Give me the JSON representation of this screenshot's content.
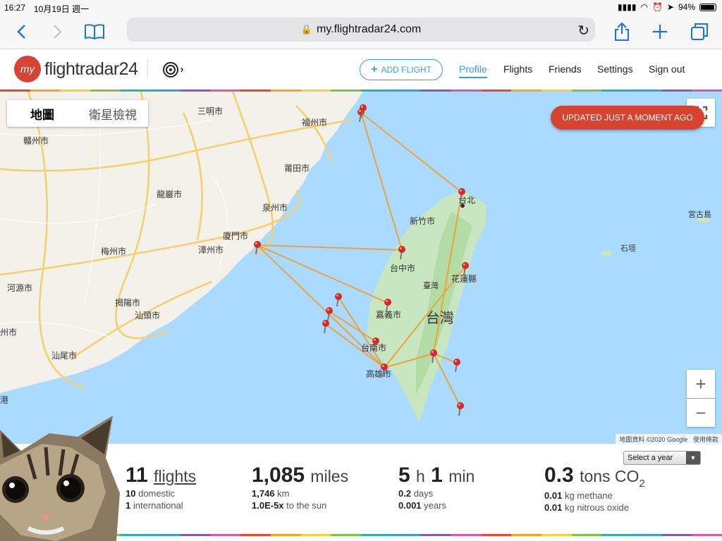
{
  "status_bar": {
    "time": "16:27",
    "date": "10月19日 週一",
    "battery": "94%",
    "battery_level": 0.94
  },
  "browser": {
    "url": "my.flightradar24.com",
    "icons": [
      "back-icon",
      "forward-icon",
      "bookmarks-icon",
      "lock-icon",
      "reload-icon",
      "share-icon",
      "new-tab-icon",
      "tabs-icon"
    ]
  },
  "header": {
    "logo_my": "my",
    "logo_text": "flightradar24",
    "add_flight": "ADD FLIGHT",
    "nav": [
      "Profile",
      "Flights",
      "Friends",
      "Settings",
      "Sign out"
    ],
    "active_nav": "Profile",
    "strip_colors": [
      "#e8482f",
      "#f6a623",
      "#f3d23b",
      "#7dc243",
      "#2ab3a6",
      "#3a9fd8",
      "#8a58b6",
      "#e05aa0"
    ]
  },
  "map": {
    "type_tabs": [
      "地圖",
      "衛星檢視"
    ],
    "selected_type": "地圖",
    "updated_badge": "UPDATED JUST A MOMENT AGO",
    "zoom_in": "+",
    "zoom_out": "−",
    "attribution": "地圖資料 ©2020 Google",
    "terms": "使用條款",
    "labels": {
      "sanming": "三明市",
      "fuzhou": "福州市",
      "ganzhou": "贛州市",
      "putian": "莆田市",
      "longyan": "龍巖市",
      "quanzhou": "泉州市",
      "xiamen": "廈門市",
      "zhangzhou": "漳州市",
      "meizhou": "梅州市",
      "heyuan": "河源市",
      "jieyang": "揭陽市",
      "shantou": "汕頭市",
      "zhou": "州市",
      "shanwei": "汕尾市",
      "gang": "港",
      "taipei": "台北",
      "hsinchu": "新竹市",
      "taichung": "台中市",
      "taiwan_small": "臺灣",
      "hualien": "花蓮縣",
      "chiayi": "嘉義市",
      "taiwan": "台灣",
      "tainan": "台南市",
      "kaohsiung": "高雄市",
      "miyako": "宮古島",
      "ishigaki": "石垣"
    },
    "colors": {
      "land": "#f3f1ea",
      "sea": "#aadaff",
      "taiwan": "#c8e6c0",
      "route": "#eba33a",
      "pin": "#d62a2a",
      "road": "#f5cf6a"
    }
  },
  "stats": {
    "year_select": "Select a year",
    "flights": {
      "value": "11",
      "unit": "flights",
      "sub1_val": "10",
      "sub1": "domestic",
      "sub2_val": "1",
      "sub2": "international"
    },
    "distance": {
      "value": "1,085",
      "unit": "miles",
      "sub1_val": "1,746",
      "sub1": "km",
      "sub2_val": "1.0E-5x",
      "sub2": "to the sun"
    },
    "time": {
      "hours": "5",
      "h_unit": "h",
      "minutes": "1",
      "m_unit": "min",
      "sub1_val": "0.2",
      "sub1": "days",
      "sub2_val": "0.001",
      "sub2": "years"
    },
    "co2": {
      "value": "0.3",
      "unit": "tons CO",
      "unit_sub": "2",
      "sub1_val": "0.01",
      "sub1": "kg methane",
      "sub2_val": "0.01",
      "sub2": "kg nitrous oxide"
    }
  }
}
